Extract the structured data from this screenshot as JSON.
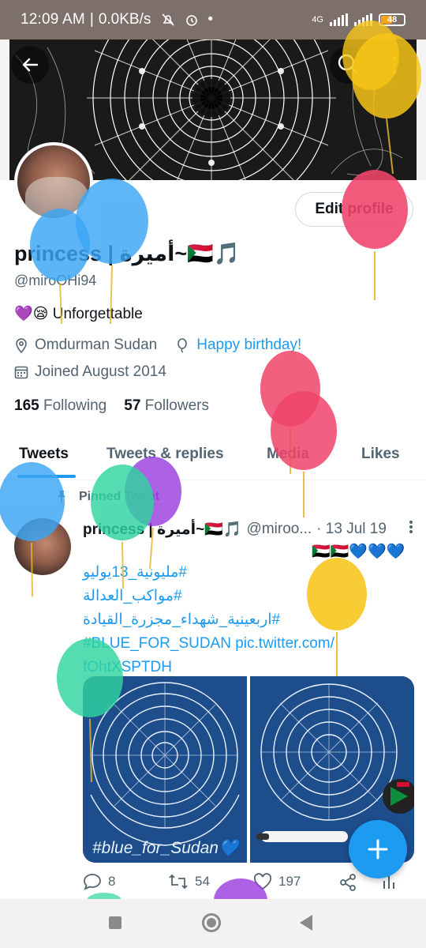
{
  "status_bar": {
    "time": "12:09 AM",
    "speed": "0.0KB/s",
    "network": "4G",
    "battery": "48"
  },
  "profile": {
    "edit_button": "Edit profile",
    "display_name": "princess | أميرة~🇸🇩🎵",
    "handle": "@miroOHi94",
    "bio": "💜😪 Unforgettable",
    "location": "Omdurman Sudan",
    "birthday": "Happy birthday!",
    "joined": "Joined August 2014",
    "following_count": "165",
    "following_label": "Following",
    "followers_count": "57",
    "followers_label": "Followers"
  },
  "tabs": [
    {
      "label": "Tweets",
      "active": true
    },
    {
      "label": "Tweets & replies",
      "active": false
    },
    {
      "label": "Media",
      "active": false
    },
    {
      "label": "Likes",
      "active": false
    }
  ],
  "tweet": {
    "pinned_label": "Pinned Tweet",
    "author_name": "princess | أميرة~🇸🇩🎵",
    "author_handle": "@miroo...",
    "date": "· 13 Jul 19",
    "emojis": "🇸🇩🇸🇩💙💙💙",
    "hashtags": [
      "#مليونية_13يوليو",
      "#مواكب_العدالة",
      "#اربعينية_شهداء_مجزرة_القيادة",
      "#BLUE_FOR_SUDAN pic.twitter.com/",
      "fOhtXSPTDH"
    ],
    "media_caption": "#blue_for_Sudan💙",
    "replies": "8",
    "retweets": "54",
    "likes": "197"
  },
  "icons": {
    "back": "arrow-left-icon",
    "search": "search-icon",
    "more": "more-vertical-icon",
    "location": "location-pin-icon",
    "balloon": "balloon-icon",
    "calendar": "calendar-icon",
    "pin": "pin-icon",
    "reply": "reply-icon",
    "retweet": "retweet-icon",
    "like": "heart-icon",
    "share": "share-icon",
    "compose": "plus-icon"
  },
  "colors": {
    "accent": "#1d9bf0",
    "status_bar": "#7d6f6a",
    "text": "#0f1419",
    "secondary": "#536471"
  }
}
